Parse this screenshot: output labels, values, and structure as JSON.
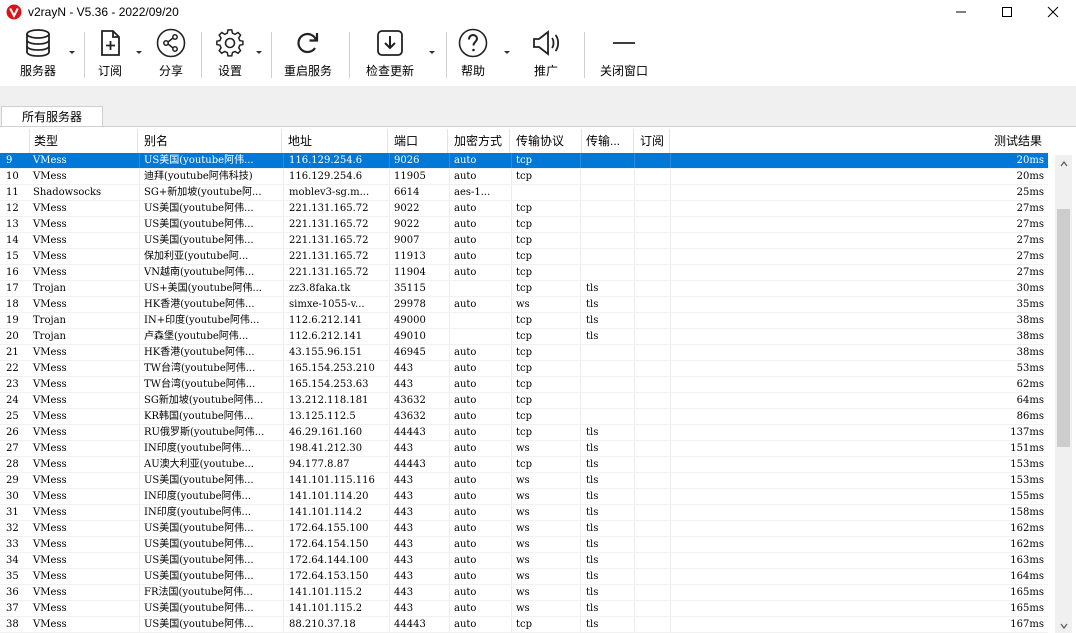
{
  "window": {
    "title": "v2rayN - V5.36 - 2022/09/20"
  },
  "toolbar": {
    "servers": "服务器",
    "subscribe": "订阅",
    "share": "分享",
    "settings": "设置",
    "restart": "重启服务",
    "check_update": "检查更新",
    "help": "帮助",
    "promote": "推广",
    "close_window": "关闭窗口"
  },
  "tabs": [
    {
      "label": "所有服务器",
      "active": true
    }
  ],
  "table": {
    "headers": [
      "类型",
      "别名",
      "地址",
      "端口",
      "加密方式",
      "传输协议",
      "传输...",
      "订阅",
      "测试结果"
    ],
    "selected_index": 0,
    "rows": [
      [
        "9",
        "VMess",
        "US美国(youtube阿伟...",
        "116.129.254.6",
        "9026",
        "auto",
        "tcp",
        "",
        "",
        "20ms"
      ],
      [
        "10",
        "VMess",
        "迪拜(youtube阿伟科技)",
        "116.129.254.6",
        "11905",
        "auto",
        "tcp",
        "",
        "",
        "20ms"
      ],
      [
        "11",
        "Shadowsocks",
        "SG+新加坡(youtube阿...",
        "moblev3-sg.m...",
        "6614",
        "aes-1...",
        "",
        "",
        "",
        "25ms"
      ],
      [
        "12",
        "VMess",
        "US美国(youtube阿伟...",
        "221.131.165.72",
        "9022",
        "auto",
        "tcp",
        "",
        "",
        "27ms"
      ],
      [
        "13",
        "VMess",
        "US美国(youtube阿伟...",
        "221.131.165.72",
        "9022",
        "auto",
        "tcp",
        "",
        "",
        "27ms"
      ],
      [
        "14",
        "VMess",
        "US美国(youtube阿伟...",
        "221.131.165.72",
        "9007",
        "auto",
        "tcp",
        "",
        "",
        "27ms"
      ],
      [
        "15",
        "VMess",
        "保加利亚(youtube阿...",
        "221.131.165.72",
        "11913",
        "auto",
        "tcp",
        "",
        "",
        "27ms"
      ],
      [
        "16",
        "VMess",
        "VN越南(youtube阿伟...",
        "221.131.165.72",
        "11904",
        "auto",
        "tcp",
        "",
        "",
        "27ms"
      ],
      [
        "17",
        "Trojan",
        "US+美国(youtube阿伟...",
        "zz3.8faka.tk",
        "35115",
        "",
        "tcp",
        "tls",
        "",
        "30ms"
      ],
      [
        "18",
        "VMess",
        "HK香港(youtube阿伟...",
        "simxe-1055-v...",
        "29978",
        "auto",
        "ws",
        "tls",
        "",
        "35ms"
      ],
      [
        "19",
        "Trojan",
        "IN+印度(youtube阿伟...",
        "112.6.212.141",
        "49000",
        "",
        "tcp",
        "tls",
        "",
        "38ms"
      ],
      [
        "20",
        "Trojan",
        "卢森堡(youtube阿伟...",
        "112.6.212.141",
        "49010",
        "",
        "tcp",
        "tls",
        "",
        "38ms"
      ],
      [
        "21",
        "VMess",
        "HK香港(youtube阿伟...",
        "43.155.96.151",
        "46945",
        "auto",
        "tcp",
        "",
        "",
        "38ms"
      ],
      [
        "22",
        "VMess",
        "TW台湾(youtube阿伟...",
        "165.154.253.210",
        "443",
        "auto",
        "tcp",
        "",
        "",
        "53ms"
      ],
      [
        "23",
        "VMess",
        "TW台湾(youtube阿伟...",
        "165.154.253.63",
        "443",
        "auto",
        "tcp",
        "",
        "",
        "62ms"
      ],
      [
        "24",
        "VMess",
        "SG新加坡(youtube阿伟...",
        "13.212.118.181",
        "43632",
        "auto",
        "tcp",
        "",
        "",
        "64ms"
      ],
      [
        "25",
        "VMess",
        "KR韩国(youtube阿伟...",
        "13.125.112.5",
        "43632",
        "auto",
        "tcp",
        "",
        "",
        "86ms"
      ],
      [
        "26",
        "VMess",
        "RU俄罗斯(youtube阿伟...",
        "46.29.161.160",
        "44443",
        "auto",
        "tcp",
        "tls",
        "",
        "137ms"
      ],
      [
        "27",
        "VMess",
        "IN印度(youtube阿伟...",
        "198.41.212.30",
        "443",
        "auto",
        "ws",
        "tls",
        "",
        "151ms"
      ],
      [
        "28",
        "VMess",
        "AU澳大利亚(youtube...",
        "94.177.8.87",
        "44443",
        "auto",
        "tcp",
        "tls",
        "",
        "153ms"
      ],
      [
        "29",
        "VMess",
        "US美国(youtube阿伟...",
        "141.101.115.116",
        "443",
        "auto",
        "ws",
        "tls",
        "",
        "153ms"
      ],
      [
        "30",
        "VMess",
        "IN印度(youtube阿伟...",
        "141.101.114.20",
        "443",
        "auto",
        "ws",
        "tls",
        "",
        "155ms"
      ],
      [
        "31",
        "VMess",
        "IN印度(youtube阿伟...",
        "141.101.114.2",
        "443",
        "auto",
        "ws",
        "tls",
        "",
        "158ms"
      ],
      [
        "32",
        "VMess",
        "US美国(youtube阿伟...",
        "172.64.155.100",
        "443",
        "auto",
        "ws",
        "tls",
        "",
        "162ms"
      ],
      [
        "33",
        "VMess",
        "US美国(youtube阿伟...",
        "172.64.154.150",
        "443",
        "auto",
        "ws",
        "tls",
        "",
        "162ms"
      ],
      [
        "34",
        "VMess",
        "US美国(youtube阿伟...",
        "172.64.144.100",
        "443",
        "auto",
        "ws",
        "tls",
        "",
        "163ms"
      ],
      [
        "35",
        "VMess",
        "US美国(youtube阿伟...",
        "172.64.153.150",
        "443",
        "auto",
        "ws",
        "tls",
        "",
        "164ms"
      ],
      [
        "36",
        "VMess",
        "FR法国(youtube阿伟...",
        "141.101.115.2",
        "443",
        "auto",
        "ws",
        "tls",
        "",
        "165ms"
      ],
      [
        "37",
        "VMess",
        "US美国(youtube阿伟...",
        "141.101.115.2",
        "443",
        "auto",
        "ws",
        "tls",
        "",
        "165ms"
      ],
      [
        "38",
        "VMess",
        "US美国(youtube阿伟...",
        "88.210.37.18",
        "44443",
        "auto",
        "tcp",
        "tls",
        "",
        "167ms"
      ]
    ]
  },
  "colors": {
    "selection": "#0078d7",
    "logo": "#d7141a"
  }
}
